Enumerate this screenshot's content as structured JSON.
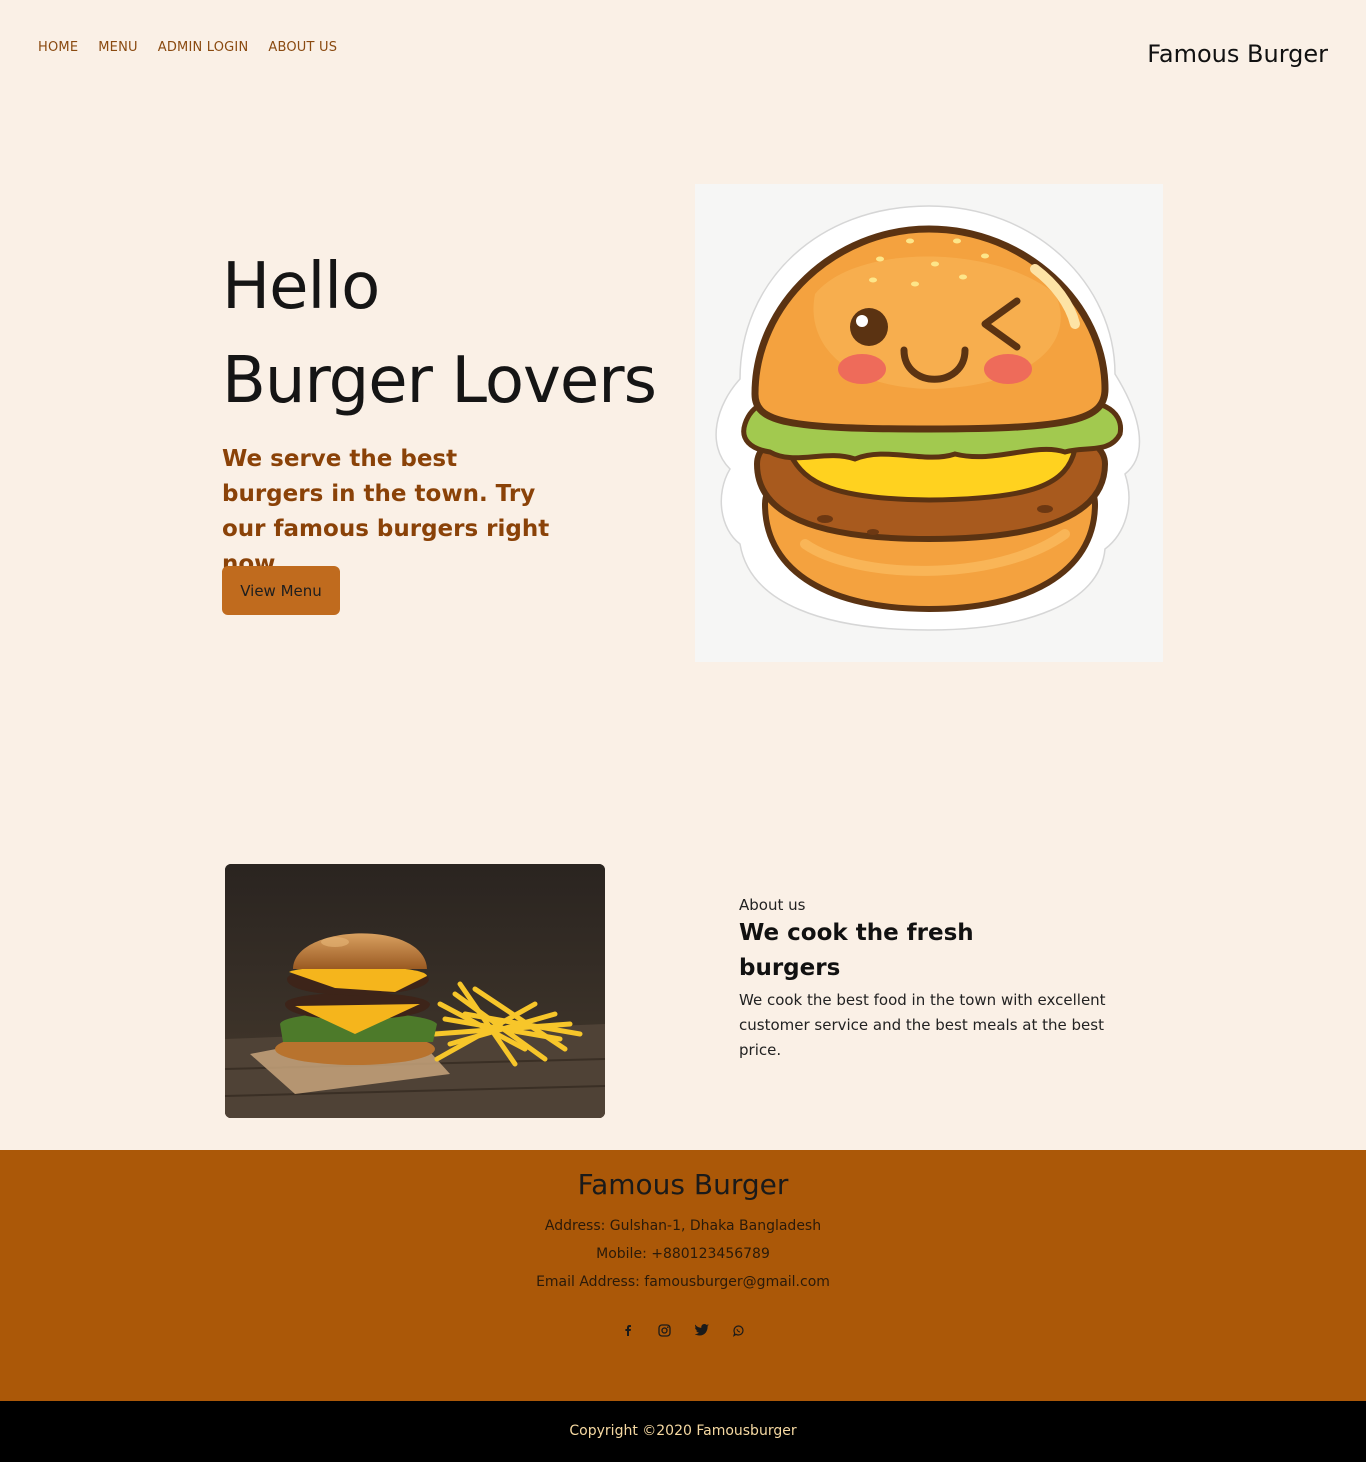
{
  "nav": {
    "items": [
      {
        "label": "HOME"
      },
      {
        "label": "MENU"
      },
      {
        "label": "ADMIN LOGIN"
      },
      {
        "label": "ABOUT US"
      }
    ],
    "brand": "Famous Burger"
  },
  "hero": {
    "title_line1": "Hello",
    "title_line2": "Burger Lovers",
    "subtitle": "We serve the best burgers in the town. Try our famous burgers right now.",
    "button_label": "View Menu"
  },
  "about": {
    "eyebrow": "About us",
    "title": "We cook the fresh burgers",
    "body": "We cook the best food in the town with excellent customer service and the best meals at the best price."
  },
  "footer": {
    "title": "Famous Burger",
    "address": "Address: Gulshan-1, Dhaka Bangladesh",
    "mobile": "Mobile: +880123456789",
    "email": "Email Address: famousburger@gmail.com",
    "socials": [
      "facebook-icon",
      "instagram-icon",
      "twitter-icon",
      "whatsapp-icon"
    ],
    "copyright": "Copyright ©2020 Famousburger"
  },
  "colors": {
    "background": "#faf0e6",
    "accent": "#c06b1e",
    "footer": "#ab5808",
    "nav_text": "#8a4a10"
  }
}
